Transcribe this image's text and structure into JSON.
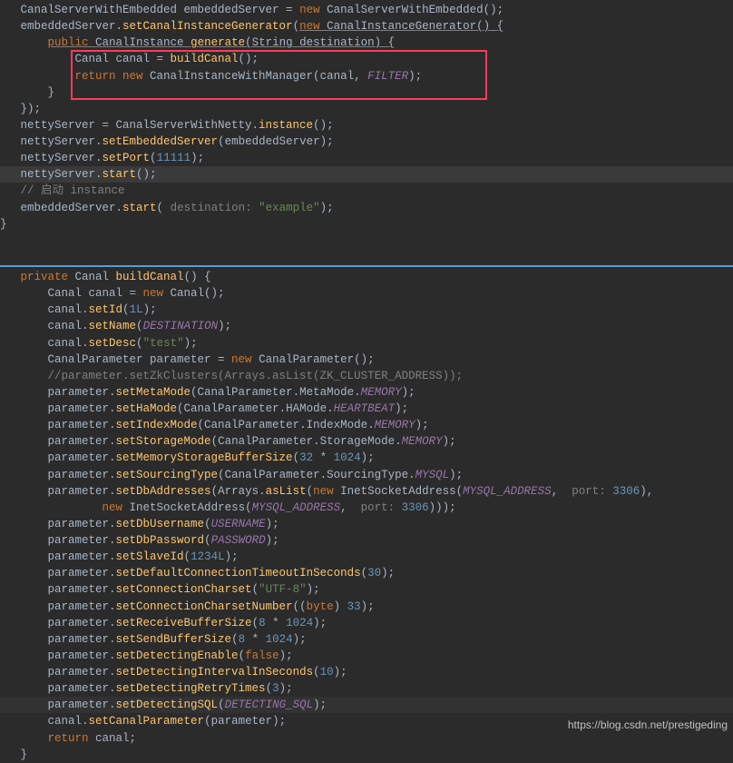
{
  "top": {
    "l1": "   CanalServerWithEmbedded embeddedServer = ",
    "l1b": "new",
    "l1c": " CanalServerWithEmbedded();",
    "l2": "   embeddedServer.",
    "l2m": "setCanalInstanceGenerator",
    "l2p": "(",
    "l2n": "new",
    "l2g": " CanalInstanceGenerator() {",
    "l3": "       ",
    "l3k": "public",
    "l3b": " CanalInstance ",
    "l3m": "generate",
    "l3c": "(String destination) {",
    "l4": "           Canal canal = ",
    "l4m": "buildCanal",
    "l4c": "();",
    "l5": "           ",
    "l5k": "return new",
    "l5c": " CanalInstanceWithManager(canal, ",
    "l5f": "FILTER",
    "l5e": ");",
    "l6": "       }",
    "l7": "   });",
    "l8": "",
    "l9": "   nettyServer = CanalServerWithNetty.",
    "l9m": "instance",
    "l9c": "();",
    "l10": "   nettyServer.",
    "l10m": "setEmbeddedServer",
    "l10c": "(embeddedServer);",
    "l11": "   nettyServer.",
    "l11m": "setPort",
    "l11c": "(",
    "l11n": "11111",
    "l11e": ");",
    "l12": "   nettyServer.",
    "l12m": "start",
    "l12c": "();",
    "l13": "",
    "l14": "   // 启动 instance",
    "l15": "   embeddedServer.",
    "l15m": "start",
    "l15p": "(",
    "l15h": " destination: ",
    "l15s": "\"example\"",
    "l15e": ");",
    "l16": "}"
  },
  "bottom": {
    "b1": "   ",
    "b1k": "private",
    "b1b": " Canal ",
    "b1m": "buildCanal",
    "b1c": "() {",
    "b2": "       Canal canal = ",
    "b2k": "new",
    "b2c": " Canal();",
    "b3": "       canal.",
    "b3m": "setId",
    "b3c": "(",
    "b3n": "1L",
    "b3e": ");",
    "b4": "       canal.",
    "b4m": "setName",
    "b4c": "(",
    "b4f": "DESTINATION",
    "b4e": ");",
    "b5": "       canal.",
    "b5m": "setDesc",
    "b5c": "(",
    "b5s": "\"test\"",
    "b5e": ");",
    "b6": "",
    "b7": "       CanalParameter parameter = ",
    "b7k": "new",
    "b7c": " CanalParameter();",
    "b8": "       //parameter.setZkClusters(Arrays.asList(ZK_CLUSTER_ADDRESS));",
    "b9": "       parameter.",
    "b9m": "setMetaMode",
    "b9c": "(CanalParameter.MetaMode.",
    "b9f": "MEMORY",
    "b9e": ");",
    "b10": "       parameter.",
    "b10m": "setHaMode",
    "b10c": "(CanalParameter.HAMode.",
    "b10f": "HEARTBEAT",
    "b10e": ");",
    "b11": "       parameter.",
    "b11m": "setIndexMode",
    "b11c": "(CanalParameter.IndexMode.",
    "b11f": "MEMORY",
    "b11e": ");",
    "b12": "       parameter.",
    "b12m": "setStorageMode",
    "b12c": "(CanalParameter.StorageMode.",
    "b12f": "MEMORY",
    "b12e": ");",
    "b13": "       parameter.",
    "b13m": "setMemoryStorageBufferSize",
    "b13c": "(",
    "b13n": "32",
    "b13o": " * ",
    "b13p": "1024",
    "b13e": ");",
    "b14": "       parameter.",
    "b14m": "setSourcingType",
    "b14c": "(CanalParameter.SourcingType.",
    "b14f": "MYSQL",
    "b14e": ");",
    "b15": "       parameter.",
    "b15m": "setDbAddresses",
    "b15c": "(Arrays.",
    "b15a": "asList",
    "b15d": "(",
    "b15k": "new",
    "b15i": " InetSocketAddress(",
    "b15f": "MYSQL_ADDRESS",
    "b15g": ", ",
    "b15h": " port: ",
    "b15n": "3306",
    "b15e": "),",
    "b16": "               ",
    "b16k": "new",
    "b16c": " InetSocketAddress(",
    "b16f": "MYSQL_ADDRESS",
    "b16g": ", ",
    "b16h": " port: ",
    "b16n": "3306",
    "b16e": ")));",
    "b17": "       parameter.",
    "b17m": "setDbUsername",
    "b17c": "(",
    "b17f": "USERNAME",
    "b17e": ");",
    "b18": "       parameter.",
    "b18m": "setDbPassword",
    "b18c": "(",
    "b18f": "PASSWORD",
    "b18e": ");",
    "b19": "       parameter.",
    "b19m": "setSlaveId",
    "b19c": "(",
    "b19n": "1234L",
    "b19e": ");",
    "b20": "       parameter.",
    "b20m": "setDefaultConnectionTimeoutInSeconds",
    "b20c": "(",
    "b20n": "30",
    "b20e": ");",
    "b21": "       parameter.",
    "b21m": "setConnectionCharset",
    "b21c": "(",
    "b21s": "\"UTF-8\"",
    "b21e": ");",
    "b22": "       parameter.",
    "b22m": "setConnectionCharsetNumber",
    "b22c": "((",
    "b22k": "byte",
    "b22d": ") ",
    "b22n": "33",
    "b22e": ");",
    "b23": "       parameter.",
    "b23m": "setReceiveBufferSize",
    "b23c": "(",
    "b23n": "8",
    "b23o": " * ",
    "b23p": "1024",
    "b23e": ");",
    "b24": "       parameter.",
    "b24m": "setSendBufferSize",
    "b24c": "(",
    "b24n": "8",
    "b24o": " * ",
    "b24p": "1024",
    "b24e": ");",
    "b25": "       parameter.",
    "b25m": "setDetectingEnable",
    "b25c": "(",
    "b25k": "false",
    "b25e": ");",
    "b26": "       parameter.",
    "b26m": "setDetectingIntervalInSeconds",
    "b26c": "(",
    "b26n": "10",
    "b26e": ");",
    "b27": "       parameter.",
    "b27m": "setDetectingRetryTimes",
    "b27c": "(",
    "b27n": "3",
    "b27e": ");",
    "b28": "       parameter.",
    "b28m": "setDetectingSQL",
    "b28c": "(",
    "b28f": "DETECTING_SQL",
    "b28e": ");",
    "b29": "       canal.",
    "b29m": "setCanalParameter",
    "b29c": "(parameter);",
    "b30": "       ",
    "b30k": "return",
    "b30c": " canal;",
    "b31": "   }"
  },
  "watermark": "https://blog.csdn.net/prestigeding"
}
